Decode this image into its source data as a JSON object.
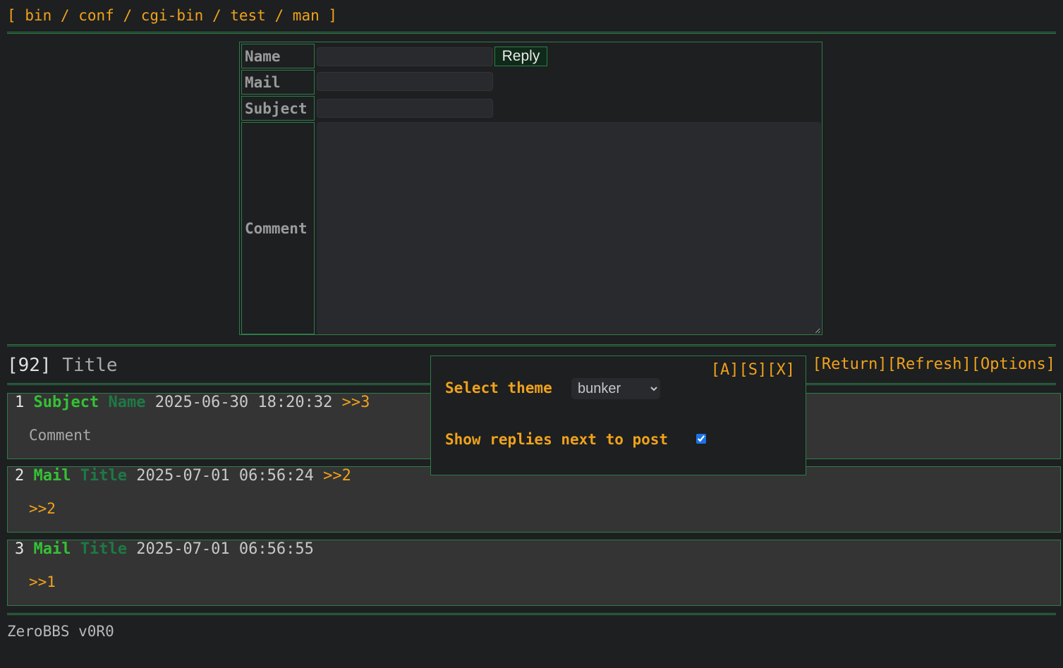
{
  "nav": {
    "open": "[",
    "boards": [
      "bin",
      "conf",
      "cgi-bin",
      "test",
      "man"
    ],
    "separator": "/",
    "close": "]"
  },
  "form": {
    "name_label": "Name",
    "mail_label": "Mail",
    "subject_label": "Subject",
    "comment_label": "Comment",
    "reply_label": "Reply",
    "name_value": "",
    "mail_value": "",
    "subject_value": "",
    "comment_value": ""
  },
  "thread": {
    "number": "[92]",
    "title": "Title",
    "links": [
      "[Return]",
      "[Refresh]",
      "[Options]"
    ]
  },
  "posts": [
    {
      "num": "1",
      "subject": "Subject",
      "name": "Name",
      "date": "2025-06-30 18:20:32",
      "replies": ">>3",
      "body": "Comment"
    },
    {
      "num": "2",
      "subject": "Mail",
      "name": "Title",
      "date": "2025-07-01 06:56:24",
      "replies": ">>2",
      "body": ">>2"
    },
    {
      "num": "3",
      "subject": "Mail",
      "name": "Title",
      "date": "2025-07-01 06:56:55",
      "replies": "",
      "body": ">>1"
    }
  ],
  "options": {
    "controls": [
      "[A]",
      "[S]",
      "[X]"
    ],
    "theme_label": "Select theme",
    "theme_value": "bunker",
    "replies_label": "Show replies next to post",
    "replies_checked": true
  },
  "footer": {
    "text": "ZeroBBS v0R0"
  },
  "colors": {
    "background": "#1d1f21",
    "accent": "#f0a21b",
    "border": "#2e7d49",
    "subject": "#34c234",
    "name": "#1d7a44",
    "post_bg": "#343434"
  }
}
